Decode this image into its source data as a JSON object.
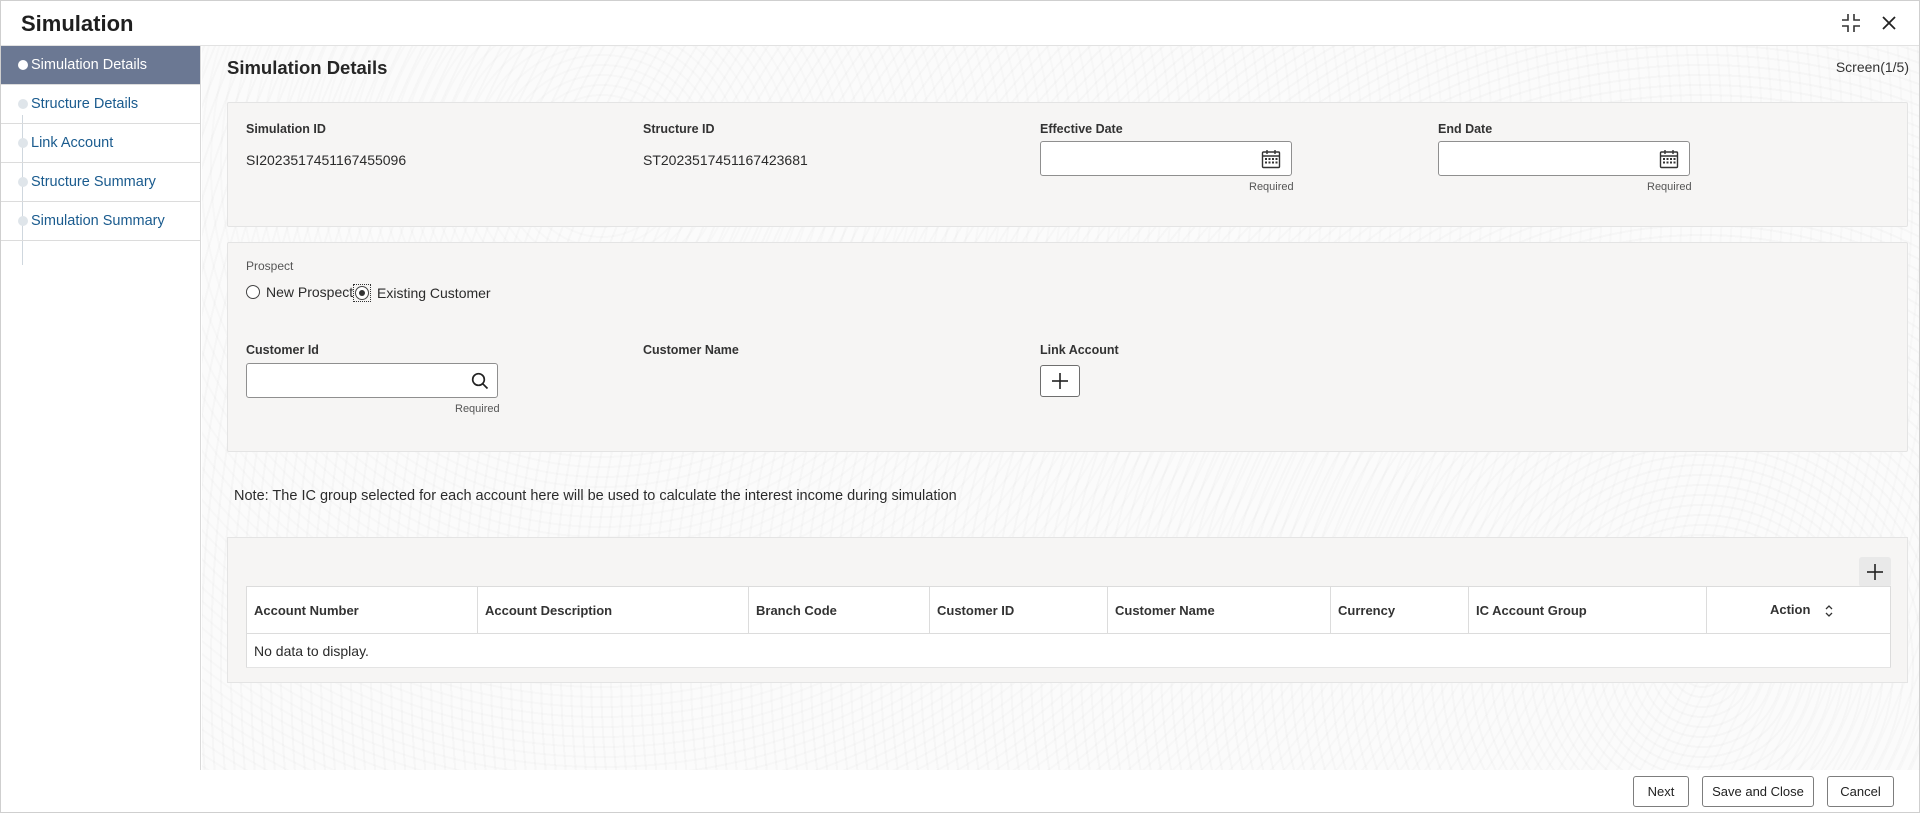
{
  "window": {
    "title": "Simulation",
    "icons": [
      "collapse-icon",
      "close-icon"
    ]
  },
  "sidebar": {
    "items": [
      {
        "label": "Simulation Details",
        "active": true
      },
      {
        "label": "Structure Details",
        "active": false
      },
      {
        "label": "Link Account",
        "active": false
      },
      {
        "label": "Structure Summary",
        "active": false
      },
      {
        "label": "Simulation Summary",
        "active": false
      }
    ]
  },
  "main": {
    "section_title": "Simulation Details",
    "screen_indicator": "Screen(1/5)"
  },
  "details": {
    "simulation_id_label": "Simulation ID",
    "simulation_id_value": "SI2023517451167455096",
    "structure_id_label": "Structure ID",
    "structure_id_value": "ST2023517451167423681",
    "effective_date_label": "Effective Date",
    "effective_date_value": "",
    "effective_date_required": "Required",
    "end_date_label": "End Date",
    "end_date_value": "",
    "end_date_required": "Required"
  },
  "prospect": {
    "label": "Prospect",
    "options": [
      {
        "label": "New Prospect",
        "checked": false
      },
      {
        "label": "Existing Customer",
        "checked": true
      }
    ],
    "customer_id_label": "Customer Id",
    "customer_id_value": "",
    "customer_id_required": "Required",
    "customer_name_label": "Customer Name",
    "link_account_label": "Link Account"
  },
  "note": "Note: The IC group selected for each account here will be used to calculate the interest income during simulation",
  "grid": {
    "columns": [
      "Account Number",
      "Account Description",
      "Branch Code",
      "Customer ID",
      "Customer Name",
      "Currency",
      "IC Account Group",
      "Action"
    ],
    "empty_message": "No data to display."
  },
  "footer": {
    "next": "Next",
    "save_close": "Save and Close",
    "cancel": "Cancel"
  },
  "colors": {
    "sidebar_active_bg": "#6b7893",
    "link_text": "#1a5b8e",
    "panel_bg": "#f6f5f4"
  }
}
